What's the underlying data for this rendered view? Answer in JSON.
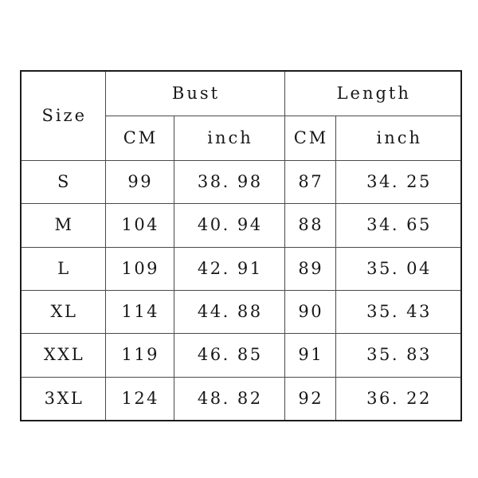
{
  "table": {
    "name": "size-chart",
    "headers": {
      "size_label": "Size",
      "groups": [
        {
          "key": "bust",
          "label": "Bust"
        },
        {
          "key": "length",
          "label": "Length"
        }
      ],
      "subcolumns": [
        {
          "group": "bust",
          "key": "cm",
          "label": "CM"
        },
        {
          "group": "bust",
          "key": "inch",
          "label": "inch"
        },
        {
          "group": "length",
          "key": "cm",
          "label": "CM"
        },
        {
          "group": "length",
          "key": "inch",
          "label": "inch"
        }
      ]
    },
    "rows": [
      {
        "size": "S",
        "bust_cm": "99",
        "bust_inch": "38. 98",
        "length_cm": "87",
        "length_inch": "34. 25"
      },
      {
        "size": "M",
        "bust_cm": "104",
        "bust_inch": "40. 94",
        "length_cm": "88",
        "length_inch": "34. 65"
      },
      {
        "size": "L",
        "bust_cm": "109",
        "bust_inch": "42. 91",
        "length_cm": "89",
        "length_inch": "35. 04"
      },
      {
        "size": "XL",
        "bust_cm": "114",
        "bust_inch": "44. 88",
        "length_cm": "90",
        "length_inch": "35. 43"
      },
      {
        "size": "XXL",
        "bust_cm": "119",
        "bust_inch": "46. 85",
        "length_cm": "91",
        "length_inch": "35. 83"
      },
      {
        "size": "3XL",
        "bust_cm": "124",
        "bust_inch": "48. 82",
        "length_cm": "92",
        "length_inch": "36. 22"
      }
    ]
  },
  "colors": {
    "background": "#ffffff",
    "border_outer": "#1c1c1c",
    "border_inner": "#4a4a4a",
    "text": "#181818"
  }
}
